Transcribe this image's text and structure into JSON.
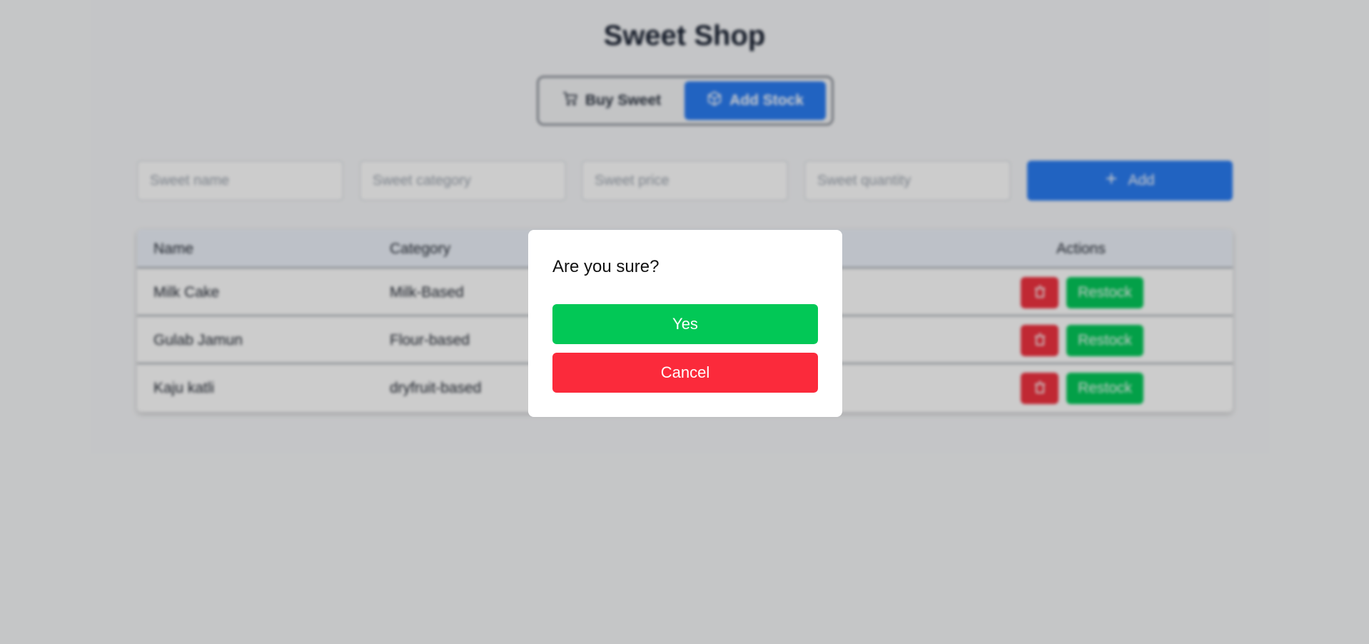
{
  "app": {
    "title": "Sweet Shop"
  },
  "mode_toggle": {
    "buy_label": "Buy Sweet",
    "add_label": "Add Stock",
    "active": "Add Stock"
  },
  "form": {
    "name_placeholder": "Sweet name",
    "category_placeholder": "Sweet category",
    "price_placeholder": "Sweet price",
    "quantity_placeholder": "Sweet quantity",
    "add_label": "Add"
  },
  "table": {
    "headers": {
      "name": "Name",
      "category": "Category",
      "actions": "Actions"
    },
    "rows": [
      {
        "name": "Milk Cake",
        "category": "Milk-Based",
        "restock_label": "Restock"
      },
      {
        "name": "Gulab Jamun",
        "category": "Flour-based",
        "restock_label": "Restock"
      },
      {
        "name": "Kaju katli",
        "category": "dryfruit-based",
        "restock_label": "Restock"
      }
    ]
  },
  "modal": {
    "title": "Are you sure?",
    "confirm_label": "Yes",
    "cancel_label": "Cancel"
  },
  "icons": {
    "buy": "cart-icon",
    "add_stock": "box-icon",
    "add": "plus-icon",
    "delete": "trash-icon"
  },
  "colors": {
    "primary": "#2a7cf2",
    "success": "#04c95a",
    "danger": "#f13240",
    "title": "#1b2333"
  }
}
